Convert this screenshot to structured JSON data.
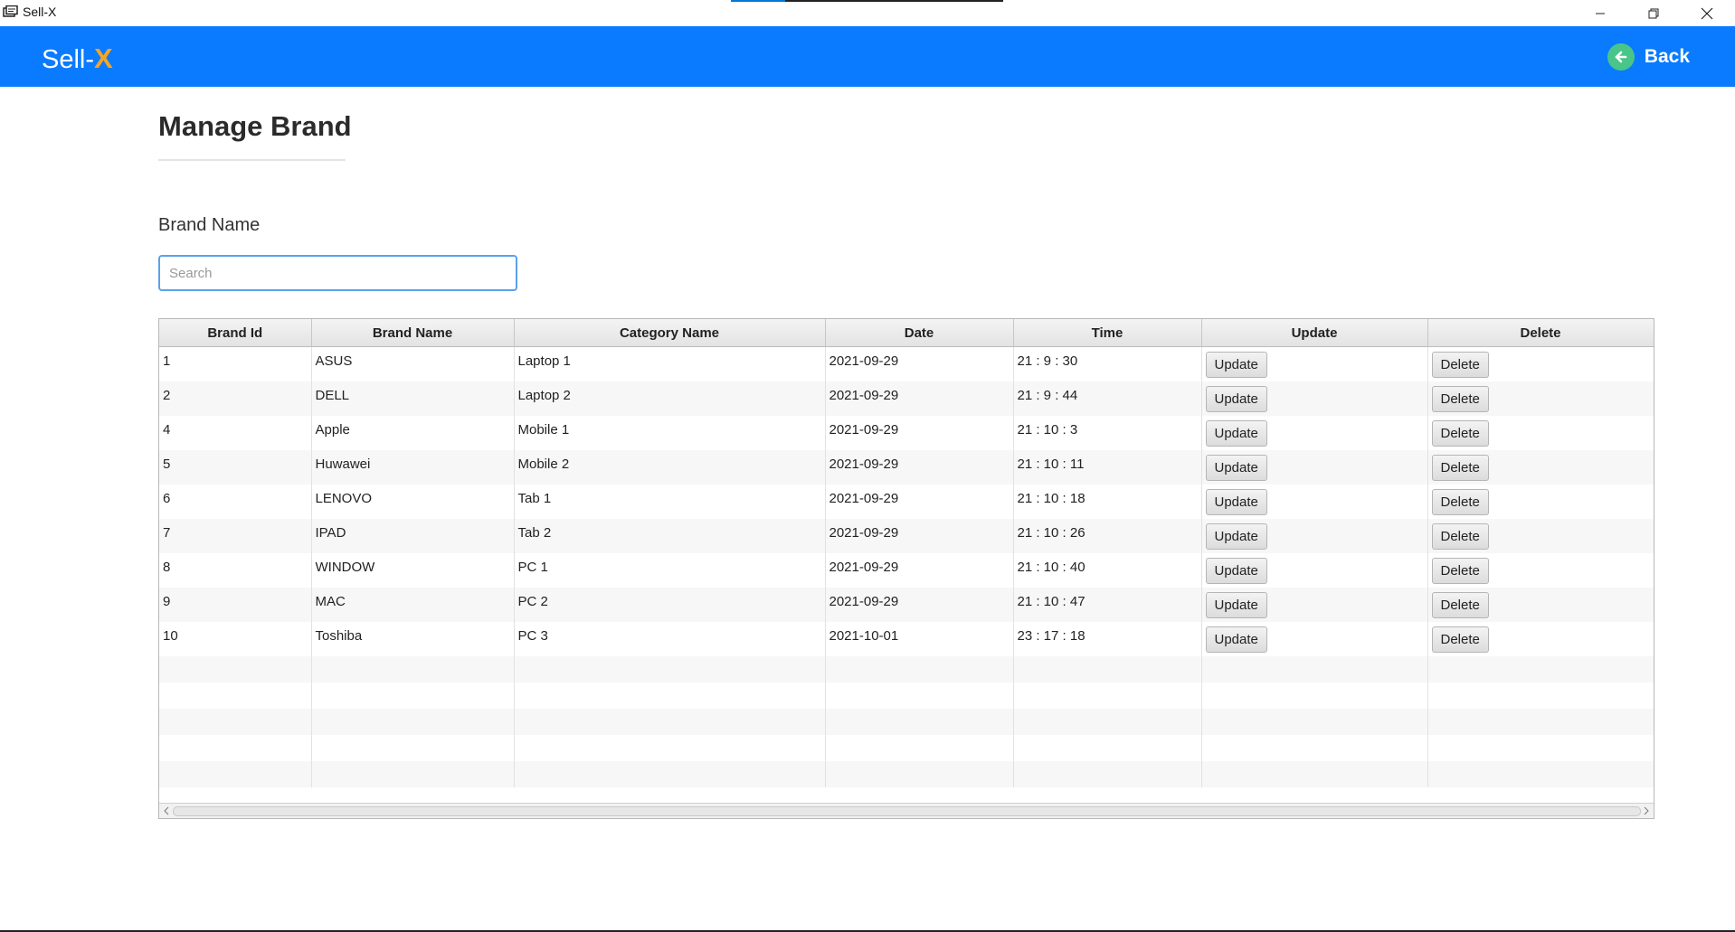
{
  "window": {
    "title": "Sell-X"
  },
  "header": {
    "logo_main": "Sell-",
    "logo_accent": "X",
    "back_label": "Back",
    "brand_color": "#0a7bff",
    "accent_color": "#f5a524",
    "back_icon_color": "#49c58a"
  },
  "page": {
    "title": "Manage Brand",
    "field_label": "Brand Name",
    "search_placeholder": "Search"
  },
  "table": {
    "columns": [
      "Brand Id",
      "Brand Name",
      "Category Name",
      "Date",
      "Time",
      "Update",
      "Delete"
    ],
    "update_label": "Update",
    "delete_label": "Delete",
    "rows": [
      {
        "id": "1",
        "brand": "ASUS",
        "category": "Laptop 1",
        "date": "2021-09-29",
        "time": "21 : 9 : 30"
      },
      {
        "id": "2",
        "brand": "DELL",
        "category": "Laptop 2",
        "date": "2021-09-29",
        "time": "21 : 9 : 44"
      },
      {
        "id": "4",
        "brand": "Apple",
        "category": "Mobile 1",
        "date": "2021-09-29",
        "time": "21 : 10 : 3"
      },
      {
        "id": "5",
        "brand": "Huwawei",
        "category": "Mobile 2",
        "date": "2021-09-29",
        "time": "21 : 10 : 11"
      },
      {
        "id": "6",
        "brand": "LENOVO",
        "category": "Tab 1",
        "date": "2021-09-29",
        "time": "21 : 10 : 18"
      },
      {
        "id": "7",
        "brand": "IPAD",
        "category": "Tab 2",
        "date": "2021-09-29",
        "time": "21 : 10 : 26"
      },
      {
        "id": "8",
        "brand": "WINDOW",
        "category": "PC 1",
        "date": "2021-09-29",
        "time": "21 : 10 : 40"
      },
      {
        "id": "9",
        "brand": "MAC",
        "category": "PC 2",
        "date": "2021-09-29",
        "time": "21 : 10 : 47"
      },
      {
        "id": "10",
        "brand": "Toshiba",
        "category": "PC 3",
        "date": "2021-10-01",
        "time": "23 : 17 : 18"
      }
    ]
  }
}
